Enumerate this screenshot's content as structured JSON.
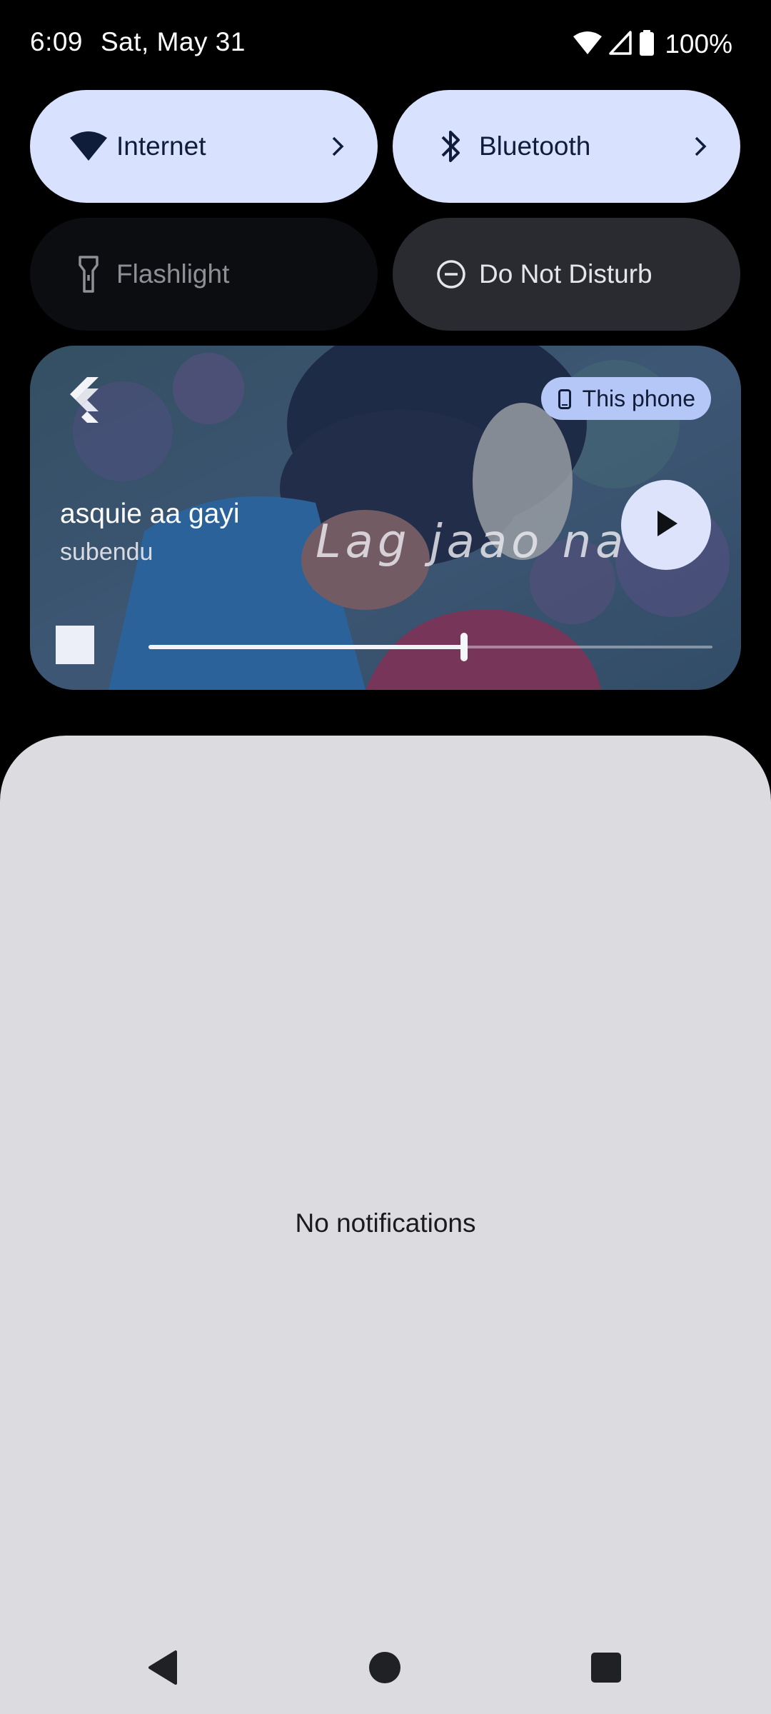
{
  "status_bar": {
    "time": "6:09",
    "date": "Sat, May 31",
    "battery_text": "100%",
    "icons": [
      "wifi-icon",
      "cell-signal-icon",
      "battery-icon"
    ]
  },
  "quick_tiles": [
    {
      "label": "Internet",
      "icon": "wifi-icon",
      "state": "on",
      "has_chevron": true
    },
    {
      "label": "Bluetooth",
      "icon": "bluetooth-icon",
      "state": "on",
      "has_chevron": true
    },
    {
      "label": "Flashlight",
      "icon": "flashlight-icon",
      "state": "unavailable"
    },
    {
      "label": "Do Not Disturb",
      "icon": "dnd-icon",
      "state": "off"
    }
  ],
  "media": {
    "app_icon": "flutter-icon",
    "output_device": "This phone",
    "title": "asquie aa gayi",
    "artist": "subendu",
    "artwork_lyric": "Lag jaao na",
    "progress": 0.56,
    "play_icon": "play-icon",
    "stop_icon": "stop-icon"
  },
  "shade": {
    "empty_text": "No notifications"
  },
  "nav": {
    "buttons": [
      "back-icon",
      "home-icon",
      "recents-icon"
    ]
  },
  "colors": {
    "tile_on": "#d8e2ff",
    "tile_off": "#2a2b30",
    "shade_bg": "#dcdbe0",
    "chip_bg": "#b5c7f6"
  }
}
